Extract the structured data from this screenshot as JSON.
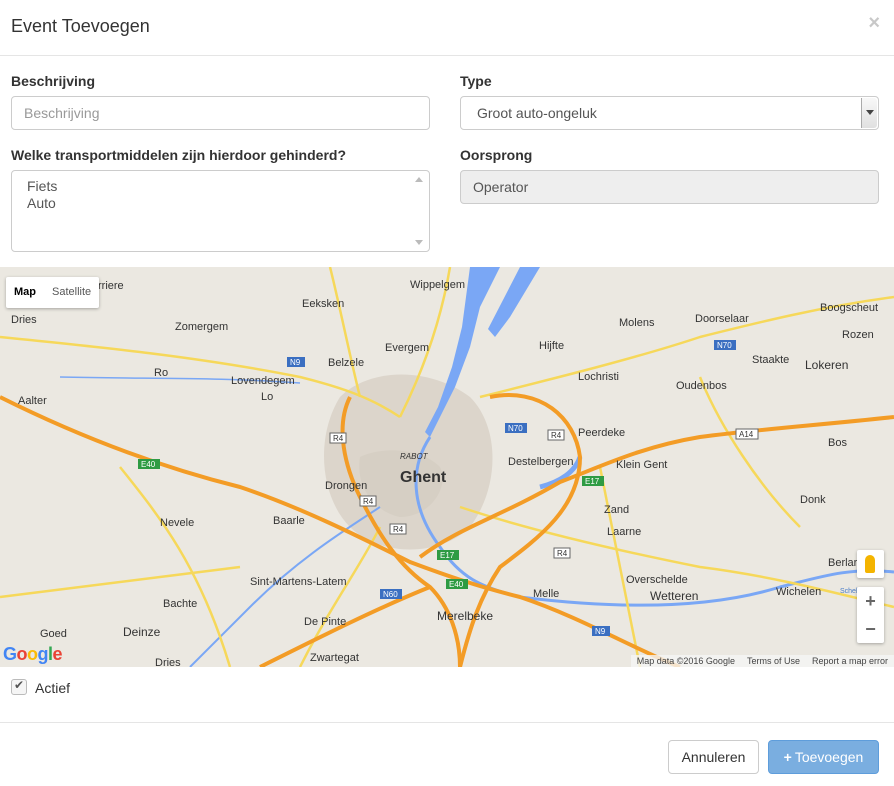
{
  "modal": {
    "title": "Event Toevoegen",
    "close": "×"
  },
  "form": {
    "description": {
      "label": "Beschrijving",
      "placeholder": "Beschrijving",
      "value": ""
    },
    "type": {
      "label": "Type",
      "selected": "Groot auto-ongeluk"
    },
    "transport": {
      "label": "Welke transportmiddelen zijn hierdoor gehinderd?",
      "options": [
        "Fiets",
        "Auto"
      ]
    },
    "origin": {
      "label": "Oorsprong",
      "value": "Operator"
    },
    "active": {
      "label": "Actief",
      "checked": true
    }
  },
  "map": {
    "type_buttons": {
      "map": "Map",
      "satellite": "Satellite",
      "active": "Map"
    },
    "google_logo": {
      "G": "G",
      "o1": "o",
      "o2": "o",
      "g": "g",
      "l": "l",
      "e": "e"
    },
    "attribution": {
      "data": "Map data ©2016 Google",
      "terms": "Terms of Use",
      "report": "Report a map error"
    },
    "zoom": {
      "in": "+",
      "out": "−"
    },
    "colors": {
      "land": "#ebe8e1",
      "water": "#7aa7f5",
      "highway": "#f39c26",
      "road": "#f6d85a",
      "city": "#dcd5cb"
    },
    "place_labels": {
      "ghent": "Ghent",
      "rabot": "RABOT",
      "eeksken": "Eeksken",
      "wippelgem": "Wippelgem",
      "zomergem": "Zomergem",
      "evergem": "Evergem",
      "belzele": "Belzele",
      "lovendegem": "Lovendegem",
      "lo": "Lo",
      "ro": "Ro",
      "dries_nw": "Dries",
      "wierriere": "rriere",
      "aalter": "Aalter",
      "hijfte": "Hijfte",
      "lochristi": "Lochristi",
      "molens": "Molens",
      "doorselaar": "Doorselaar",
      "boogscheut": "Boogscheut",
      "rozen": "Rozen",
      "staakte": "Staakte",
      "lokeren": "Lokeren",
      "oudenbos": "Oudenbos",
      "peerdeke": "Peerdeke",
      "destelbergen": "Destelbergen",
      "klein_gent": "Klein Gent",
      "bos": "Bos",
      "donk": "Donk",
      "zand": "Zand",
      "laarne": "Laarne",
      "drongen": "Drongen",
      "baarle": "Baarle",
      "nevele": "Nevele",
      "sint_martens": "Sint-Martens-Latem",
      "bachte": "Bachte",
      "de_pinte": "De Pinte",
      "deinze": "Deinze",
      "goed": "Goed",
      "dries_sw": "Dries",
      "zwartegat": "Zwartegat",
      "merelbeke": "Merelbeke",
      "melle": "Melle",
      "overschelde": "Overschelde",
      "wetteren": "Wetteren",
      "wichelen": "Wichelen",
      "berlare": "Berlar",
      "schelde": "Schelde"
    },
    "road_labels": {
      "n9_top": "N9",
      "n70_right": "N70",
      "n70_mid": "N70",
      "a14": "A14",
      "e40_left": "E40",
      "e17_right": "E17",
      "e17_mid": "E17",
      "e40_mid": "E40",
      "n60": "N60",
      "n9_bottom": "N9",
      "r4_a": "R4",
      "r4_b": "R4",
      "r4_c": "R4",
      "r4_d": "R4",
      "r4_e": "R4"
    }
  }
}
